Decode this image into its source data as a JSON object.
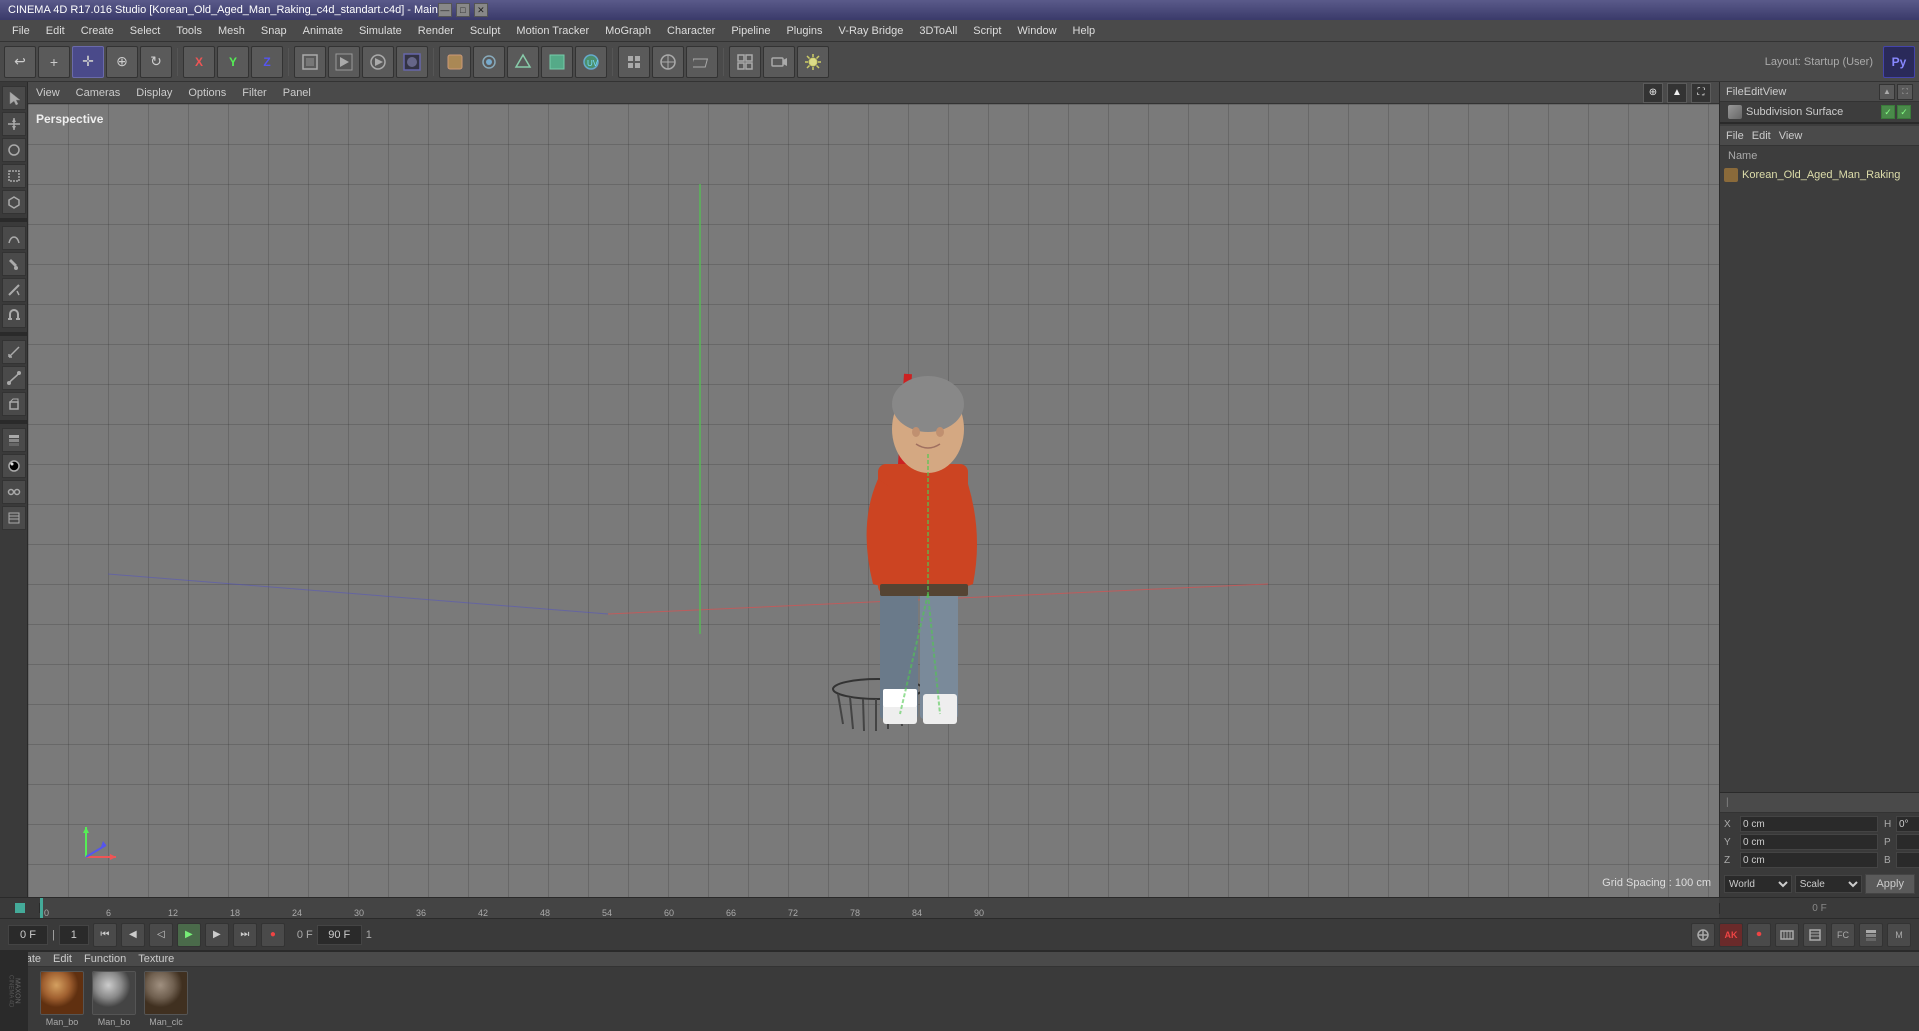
{
  "titlebar": {
    "title": "CINEMA 4D R17.016 Studio [Korean_Old_Aged_Man_Raking_c4d_standart.c4d] - Main",
    "min": "—",
    "max": "□",
    "close": "✕"
  },
  "menubar": {
    "items": [
      "File",
      "Edit",
      "Create",
      "Select",
      "Tools",
      "Mesh",
      "Snap",
      "Animate",
      "Simulate",
      "Render",
      "Sculpt",
      "Motion Tracker",
      "MoGraph",
      "Character",
      "Pipeline",
      "Plugins",
      "V-Ray Bridge",
      "3DToAll",
      "Script",
      "Window",
      "Help"
    ]
  },
  "toolbar": {
    "layout_label": "Layout: Startup (User)"
  },
  "viewport": {
    "perspective_label": "Perspective",
    "grid_spacing": "Grid Spacing : 100 cm",
    "menus": [
      "View",
      "Cameras",
      "Display",
      "Options",
      "Filter",
      "Panel"
    ]
  },
  "right_panel": {
    "top": {
      "menus": [
        "File",
        "Edit",
        "View"
      ],
      "object_name": "Subdivision Surface",
      "layout_label": "Layout: Startup (User)"
    },
    "bottom": {
      "menus": [
        "File",
        "Edit",
        "View"
      ],
      "name_label": "Name",
      "object_name": "Korean_Old_Aged_Man_Raking"
    }
  },
  "timeline": {
    "ticks": [
      "0",
      "6",
      "12",
      "18",
      "24",
      "30",
      "36",
      "42",
      "48",
      "54",
      "60",
      "66",
      "72",
      "78",
      "84",
      "90"
    ],
    "start_frame": "0 F",
    "end_frame": "90 F",
    "current_frame": "0 F",
    "frame_field": "1",
    "playback_end": "90 F",
    "final_frame": "0 F"
  },
  "materials": {
    "header_menus": [
      "Create",
      "Edit",
      "Function",
      "Texture"
    ],
    "swatches": [
      {
        "label": "Man_bo"
      },
      {
        "label": "Man_bo"
      },
      {
        "label": "Man_clc"
      }
    ]
  },
  "attributes": {
    "x_pos": "0 cm",
    "y_pos": "0 cm",
    "z_pos": "0 cm",
    "x_size": "",
    "h_val": "0°",
    "p_val": "",
    "b_val": "",
    "coord_mode": "World",
    "scale_mode": "Scale",
    "apply_label": "Apply"
  }
}
